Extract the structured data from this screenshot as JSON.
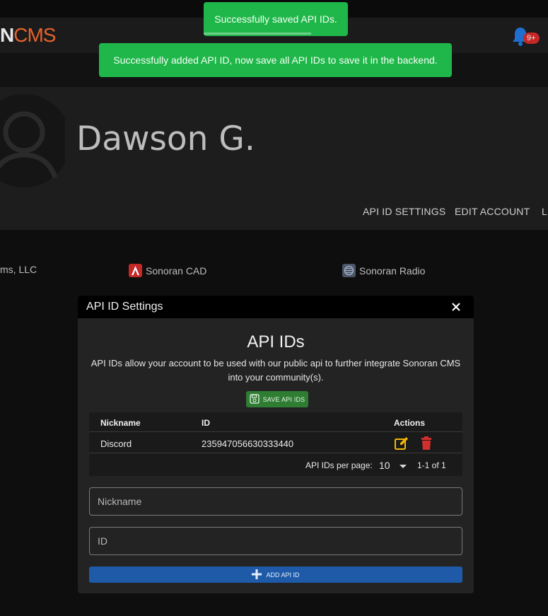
{
  "app": {
    "logo_prefix": "N",
    "logo_suffix": "CMS",
    "notification_count": "9+"
  },
  "toasts": [
    {
      "text": "Successfully saved API IDs."
    },
    {
      "text": "Successfully added API ID, now save all API IDs to save it in the backend."
    }
  ],
  "profile": {
    "name": "Dawson G.",
    "tabs": [
      "API ID SETTINGS",
      "EDIT ACCOUNT",
      "L"
    ]
  },
  "products": [
    {
      "label": "ms, LLC"
    },
    {
      "label": "Sonoran CAD",
      "icon": "sonoran-cad-icon"
    },
    {
      "label": "Sonoran Radio",
      "icon": "sonoran-radio-icon"
    }
  ],
  "modal": {
    "title": "API ID Settings",
    "heading": "API IDs",
    "description": "API IDs allow your account to be used with our public api to further integrate Sonoran CMS into your community(s).",
    "save_label": "SAVE API IDS",
    "table": {
      "columns": [
        "Nickname",
        "ID",
        "Actions"
      ],
      "rows": [
        {
          "nickname": "Discord",
          "id": "235947056630333440"
        }
      ],
      "per_page_label": "API IDs per page:",
      "per_page_value": "10",
      "range": "1-1 of 1"
    },
    "nickname_placeholder": "Nickname",
    "id_placeholder": "ID",
    "add_label": "ADD API ID"
  },
  "colors": {
    "toast": "#20b74a",
    "brand_orange": "#e8622a",
    "save_button": "#2e7d32",
    "add_button": "#1e5aa8",
    "edit_icon": "#f2b705",
    "delete_icon": "#d32f2f",
    "bell": "#1f6fd1"
  }
}
